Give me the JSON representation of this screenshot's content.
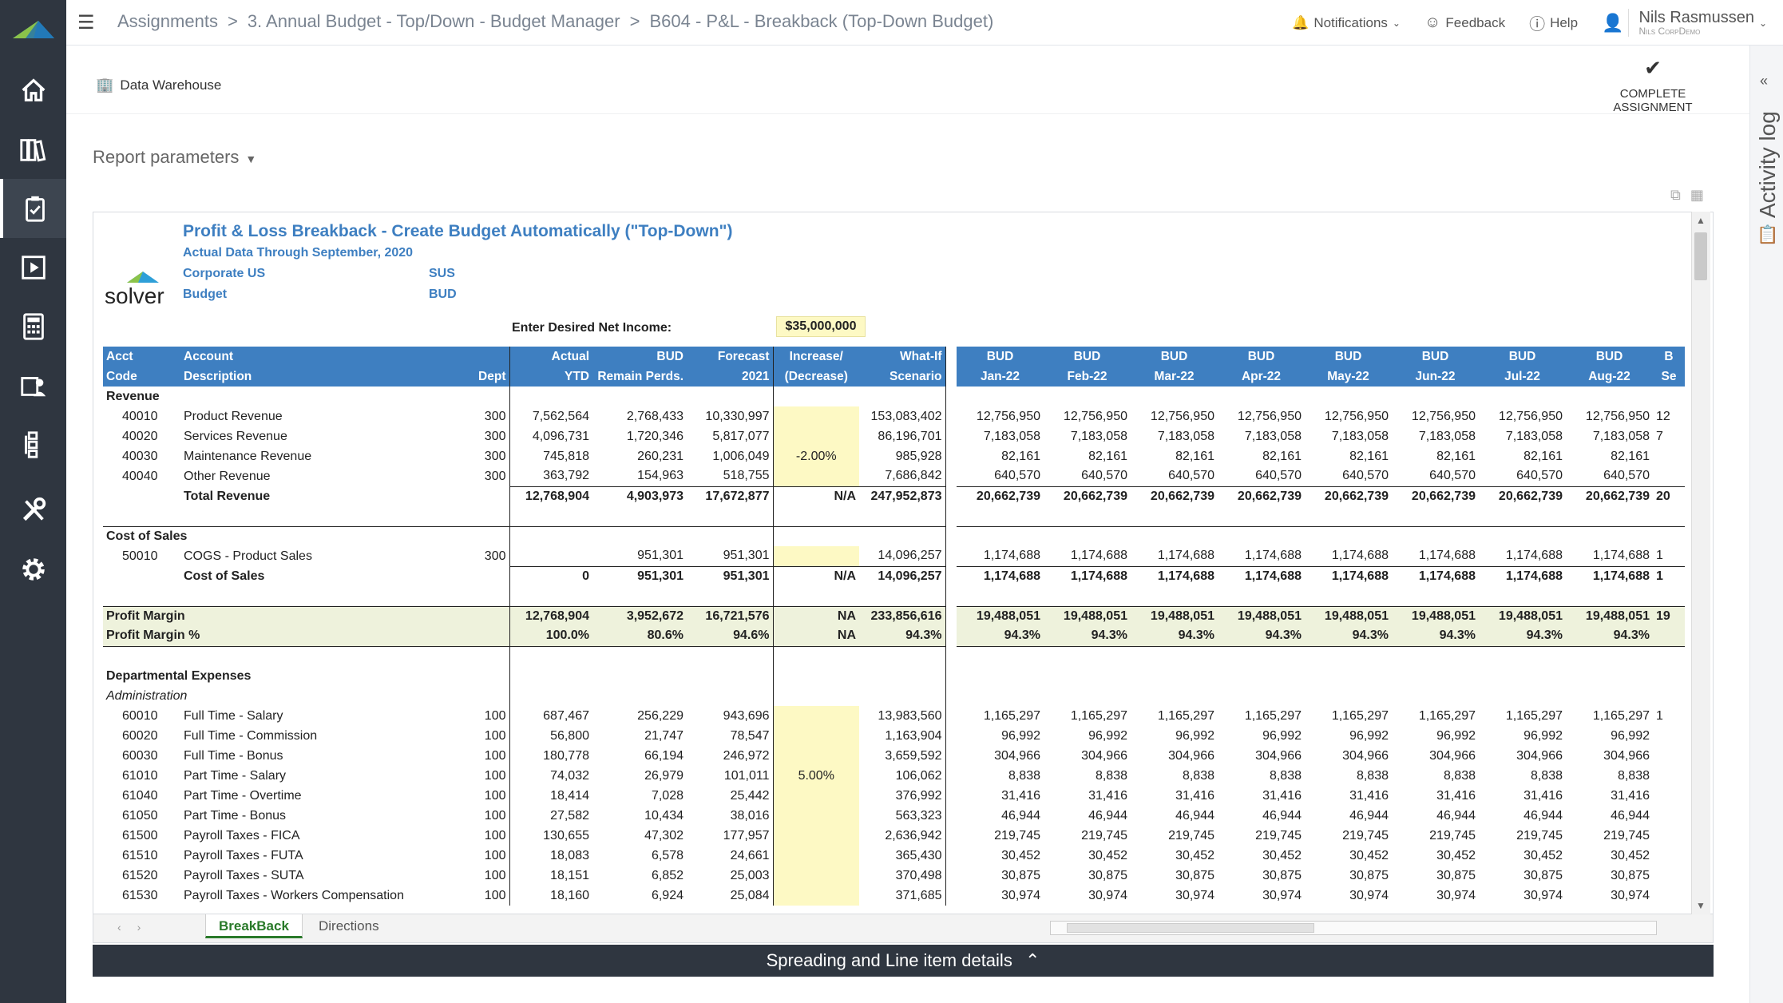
{
  "topbar": {
    "breadcrumbs": [
      "Assignments",
      "3. Annual Budget - Top/Down - Budget Manager",
      "B604 - P&L - Breakback (Top-Down Budget)"
    ],
    "notifications": "Notifications",
    "feedback": "Feedback",
    "help": "Help",
    "user_name": "Nils Rasmussen",
    "user_org": "Nils CorpDemo"
  },
  "toolbar": {
    "data_warehouse": "Data Warehouse",
    "complete_assignment": "COMPLETE ASSIGNMENT"
  },
  "report_params": "Report parameters",
  "activity_log": "Activity log",
  "report": {
    "title": "Profit & Loss Breakback - Create Budget Automatically (\"Top-Down\")",
    "subtitle": "Actual Data Through September, 2020",
    "company_label": "Corporate US",
    "company_code": "SUS",
    "scenario_label": "Budget",
    "scenario_code": "BUD",
    "logo_text": "solver",
    "net_income_label": "Enter Desired Net Income:",
    "net_income_value": "$35,000,000",
    "headers": {
      "acct": [
        "Acct",
        "Code"
      ],
      "account": [
        "Account",
        "Description"
      ],
      "dept": "Dept",
      "actual": [
        "Actual",
        "YTD"
      ],
      "bud_remain": [
        "BUD",
        "Remain Perds."
      ],
      "forecast": [
        "Forecast",
        "2021"
      ],
      "increase": [
        "Increase/",
        "(Decrease)"
      ],
      "whatif": [
        "What-If",
        "Scenario"
      ],
      "months": [
        [
          "BUD",
          "Jan-22"
        ],
        [
          "BUD",
          "Feb-22"
        ],
        [
          "BUD",
          "Mar-22"
        ],
        [
          "BUD",
          "Apr-22"
        ],
        [
          "BUD",
          "May-22"
        ],
        [
          "BUD",
          "Jun-22"
        ],
        [
          "BUD",
          "Jul-22"
        ],
        [
          "BUD",
          "Aug-22"
        ],
        [
          "B",
          "Se"
        ]
      ]
    },
    "rows": [
      {
        "type": "section",
        "label": "Revenue"
      },
      {
        "type": "line",
        "code": "40010",
        "desc": "Product Revenue",
        "dept": "300",
        "actual": "7,562,564",
        "bud": "2,768,433",
        "fc": "10,330,997",
        "inc": "",
        "wi": "153,083,402",
        "m": "12,756,950",
        "m9": "12"
      },
      {
        "type": "line",
        "code": "40020",
        "desc": "Services Revenue",
        "dept": "300",
        "actual": "4,096,731",
        "bud": "1,720,346",
        "fc": "5,817,077",
        "inc": "",
        "wi": "86,196,701",
        "m": "7,183,058",
        "m9": "7"
      },
      {
        "type": "line",
        "code": "40030",
        "desc": "Maintenance Revenue",
        "dept": "300",
        "actual": "745,818",
        "bud": "260,231",
        "fc": "1,006,049",
        "inc": "-2.00%",
        "wi": "985,928",
        "m": "82,161",
        "m9": ""
      },
      {
        "type": "line",
        "code": "40040",
        "desc": "Other Revenue",
        "dept": "300",
        "actual": "363,792",
        "bud": "154,963",
        "fc": "518,755",
        "inc": "",
        "wi": "7,686,842",
        "m": "640,570",
        "m9": ""
      },
      {
        "type": "total",
        "desc": "Total Revenue",
        "actual": "12,768,904",
        "bud": "4,903,973",
        "fc": "17,672,877",
        "inc": "N/A",
        "wi": "247,952,873",
        "m": "20,662,739",
        "m9": "20"
      },
      {
        "type": "blank"
      },
      {
        "type": "section",
        "label": "Cost of Sales",
        "boxtop": true
      },
      {
        "type": "line",
        "code": "50010",
        "desc": "COGS - Product Sales",
        "dept": "300",
        "actual": "",
        "bud": "951,301",
        "fc": "951,301",
        "inc": "",
        "wi": "14,096,257",
        "m": "1,174,688",
        "m9": "1"
      },
      {
        "type": "total",
        "desc": "Cost of Sales",
        "actual": "0",
        "bud": "951,301",
        "fc": "951,301",
        "inc": "N/A",
        "wi": "14,096,257",
        "m": "1,174,688",
        "m9": "1"
      },
      {
        "type": "blank"
      },
      {
        "type": "pm",
        "label": "Profit Margin",
        "actual": "12,768,904",
        "bud": "3,952,672",
        "fc": "16,721,576",
        "inc": "NA",
        "wi": "233,856,616",
        "m": "19,488,051",
        "m9": "19"
      },
      {
        "type": "pm2",
        "label": "Profit Margin %",
        "actual": "100.0%",
        "bud": "80.6%",
        "fc": "94.6%",
        "inc": "NA",
        "wi": "94.3%",
        "m": "94.3%",
        "m9": ""
      },
      {
        "type": "blank"
      },
      {
        "type": "section",
        "label": "Departmental Expenses"
      },
      {
        "type": "subsection",
        "label": "Administration"
      },
      {
        "type": "line",
        "code": "60010",
        "desc": "Full Time - Salary",
        "dept": "100",
        "actual": "687,467",
        "bud": "256,229",
        "fc": "943,696",
        "inc": "",
        "wi": "13,983,560",
        "m": "1,165,297",
        "m9": "1"
      },
      {
        "type": "line",
        "code": "60020",
        "desc": "Full Time - Commission",
        "dept": "100",
        "actual": "56,800",
        "bud": "21,747",
        "fc": "78,547",
        "inc": "",
        "wi": "1,163,904",
        "m": "96,992",
        "m9": ""
      },
      {
        "type": "line",
        "code": "60030",
        "desc": "Full Time - Bonus",
        "dept": "100",
        "actual": "180,778",
        "bud": "66,194",
        "fc": "246,972",
        "inc": "",
        "wi": "3,659,592",
        "m": "304,966",
        "m9": ""
      },
      {
        "type": "line",
        "code": "61010",
        "desc": "Part Time - Salary",
        "dept": "100",
        "actual": "74,032",
        "bud": "26,979",
        "fc": "101,011",
        "inc": "5.00%",
        "wi": "106,062",
        "m": "8,838",
        "m9": ""
      },
      {
        "type": "line",
        "code": "61040",
        "desc": "Part Time - Overtime",
        "dept": "100",
        "actual": "18,414",
        "bud": "7,028",
        "fc": "25,442",
        "inc": "",
        "wi": "376,992",
        "m": "31,416",
        "m9": ""
      },
      {
        "type": "line",
        "code": "61050",
        "desc": "Part Time - Bonus",
        "dept": "100",
        "actual": "27,582",
        "bud": "10,434",
        "fc": "38,016",
        "inc": "",
        "wi": "563,323",
        "m": "46,944",
        "m9": ""
      },
      {
        "type": "line",
        "code": "61500",
        "desc": "Payroll Taxes - FICA",
        "dept": "100",
        "actual": "130,655",
        "bud": "47,302",
        "fc": "177,957",
        "inc": "",
        "wi": "2,636,942",
        "m": "219,745",
        "m9": ""
      },
      {
        "type": "line",
        "code": "61510",
        "desc": "Payroll Taxes - FUTA",
        "dept": "100",
        "actual": "18,083",
        "bud": "6,578",
        "fc": "24,661",
        "inc": "",
        "wi": "365,430",
        "m": "30,452",
        "m9": ""
      },
      {
        "type": "line",
        "code": "61520",
        "desc": "Payroll Taxes - SUTA",
        "dept": "100",
        "actual": "18,151",
        "bud": "6,852",
        "fc": "25,003",
        "inc": "",
        "wi": "370,498",
        "m": "30,875",
        "m9": ""
      },
      {
        "type": "line",
        "code": "61530",
        "desc": "Payroll Taxes - Workers Compensation",
        "dept": "100",
        "actual": "18,160",
        "bud": "6,924",
        "fc": "25,084",
        "inc": "",
        "wi": "371,685",
        "m": "30,974",
        "m9": ""
      }
    ]
  },
  "sheet_tabs": [
    "BreakBack",
    "Directions"
  ],
  "bottom_bar": "Spreading and Line item details"
}
